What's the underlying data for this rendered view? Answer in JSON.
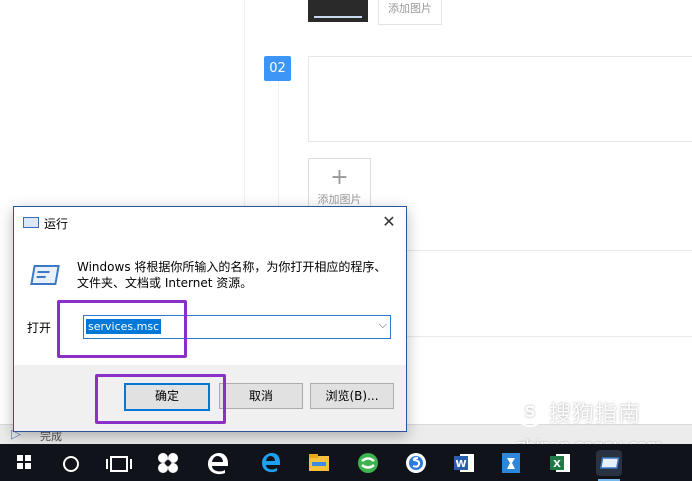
{
  "background_page": {
    "add_image_label": "添加图片",
    "step_number": "02",
    "add_image_plus": "+",
    "status_text": "完成"
  },
  "run_dialog": {
    "title": "运行",
    "close_glyph": "✕",
    "description": "Windows 将根据你所输入的名称，为你打开相应的程序、文件夹、文档或 Internet 资源。",
    "open_label": "打开",
    "open_value": "services.msc",
    "dropdown_glyph": "⌵",
    "buttons": {
      "ok": "确定",
      "cancel": "取消",
      "browse": "浏览(B)..."
    }
  },
  "watermark": {
    "logo_glyph": "S",
    "name": "搜狗指南",
    "url": "zhinan.sogou.com"
  },
  "taskbar": {
    "icons": [
      "windows-start-icon",
      "cortana-search-icon",
      "task-view-icon",
      "fan-app-icon",
      "edge-icon",
      "ie-icon",
      "file-explorer-icon",
      "360-browser-icon",
      "sogou-browser-icon",
      "word-icon",
      "pinned-app-icon",
      "excel-icon",
      "run-dialog-taskbar-icon"
    ]
  },
  "colors": {
    "accent": "#0078d7",
    "step_badge": "#3d95f5",
    "highlight": "#8b2fc9",
    "taskbar": "#10131a"
  }
}
